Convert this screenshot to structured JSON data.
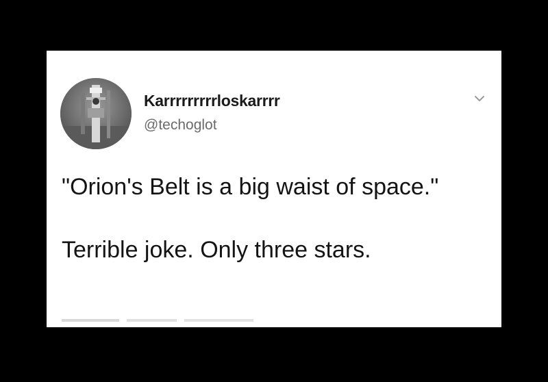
{
  "tweet": {
    "display_name": "Karrrrrrrrrloskarrrr",
    "handle": "@techoglot",
    "text_line1": "\"Orion's Belt is a big waist of space.\"",
    "text_line2": "Terrible joke. Only three stars.",
    "menu_icon": "chevron-down-icon",
    "avatar_icon": "profile-photo"
  },
  "colors": {
    "background": "#000000",
    "card": "#ffffff",
    "text": "#141414",
    "handle": "#6b6b6b"
  }
}
